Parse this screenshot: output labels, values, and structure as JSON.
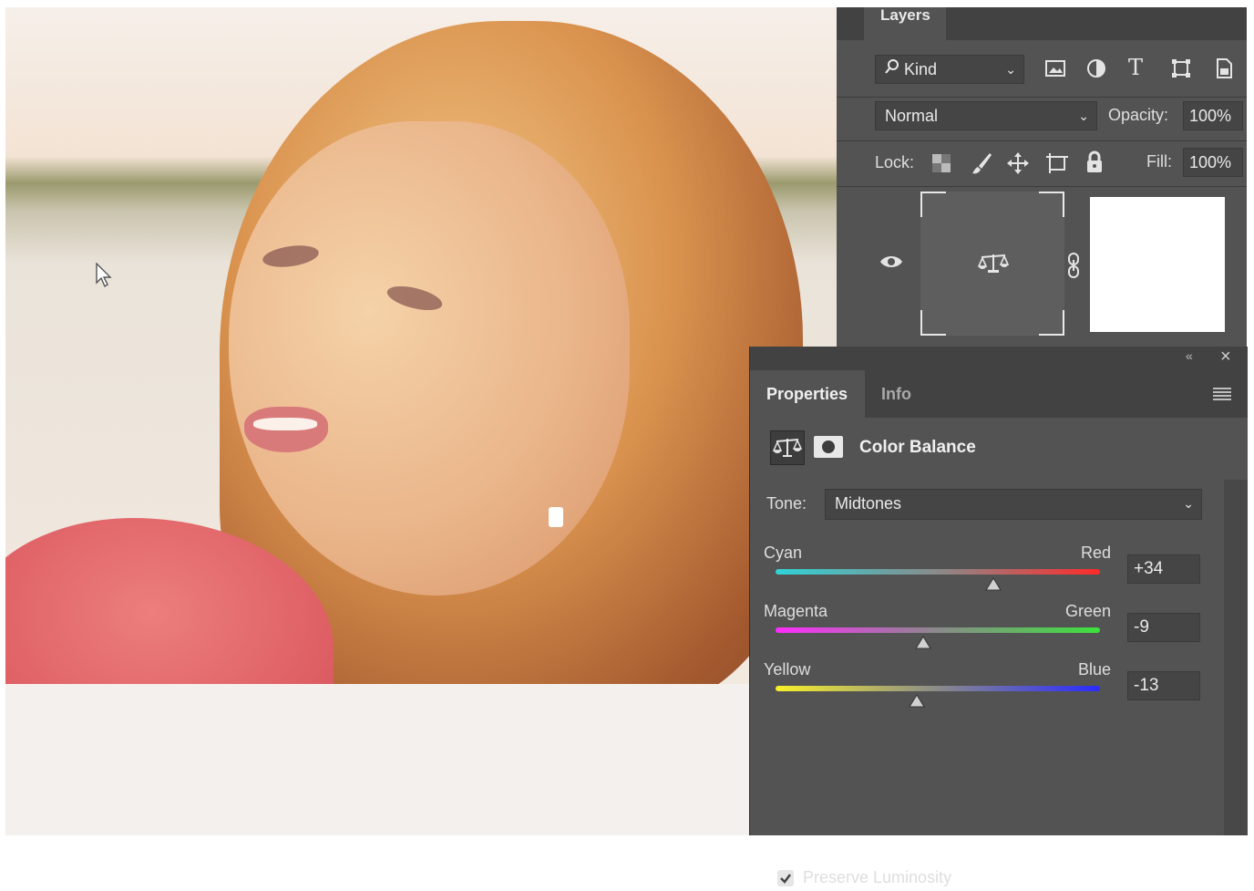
{
  "layers": {
    "tab_label": "Layers",
    "filter_kind": "Kind",
    "blend_mode": "Normal",
    "opacity_label": "Opacity:",
    "opacity_value": "100%",
    "lock_label": "Lock:",
    "fill_label": "Fill:",
    "fill_value": "100%"
  },
  "properties": {
    "tab_properties": "Properties",
    "tab_info": "Info",
    "adjustment_title": "Color Balance",
    "tone_label": "Tone:",
    "tone_value": "Midtones",
    "sliders": [
      {
        "left": "Cyan",
        "right": "Red",
        "value": "+34",
        "level": 34,
        "gradient": [
          "#2fd3d6",
          "#ff2a2a"
        ]
      },
      {
        "left": "Magenta",
        "right": "Green",
        "value": "-9",
        "level": -9,
        "gradient": [
          "#ff2cff",
          "#3ce23c"
        ]
      },
      {
        "left": "Yellow",
        "right": "Blue",
        "value": "-13",
        "level": -13,
        "gradient": [
          "#f7f02a",
          "#2a2aff"
        ]
      }
    ],
    "preserve_luminosity_label": "Preserve Luminosity",
    "preserve_luminosity": true
  },
  "colors": {
    "panel_bg": "#535353",
    "panel_dark": "#424242",
    "field_bg": "#454545",
    "text": "#e9e9e9"
  }
}
